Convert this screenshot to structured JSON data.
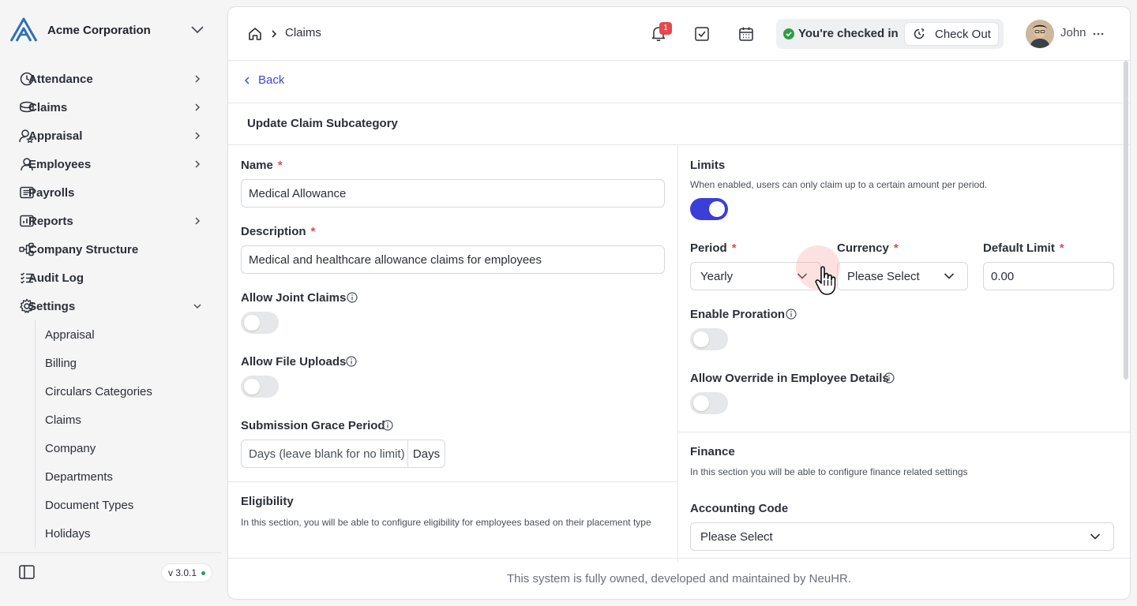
{
  "org": {
    "name": "Acme Corporation"
  },
  "sidebar": {
    "items": [
      {
        "label": "Attendance",
        "icon": "clock-icon"
      },
      {
        "label": "Claims",
        "icon": "coins-icon"
      },
      {
        "label": "Appraisal",
        "icon": "user-star-icon"
      },
      {
        "label": "Employees",
        "icon": "user-icon"
      },
      {
        "label": "Payrolls",
        "icon": "receipt-icon"
      },
      {
        "label": "Reports",
        "icon": "chart-icon"
      },
      {
        "label": "Company Structure",
        "icon": "hierarchy-icon"
      },
      {
        "label": "Audit Log",
        "icon": "list-check-icon"
      },
      {
        "label": "Settings",
        "icon": "gear-icon"
      }
    ],
    "settings_sub": [
      "Appraisal",
      "Billing",
      "Circulars Categories",
      "Claims",
      "Company",
      "Departments",
      "Document Types",
      "Holidays"
    ],
    "version": "v 3.0.1"
  },
  "header": {
    "breadcrumb": "Claims",
    "notification_count": "1",
    "checkin_status": "You're checked in",
    "checkout_label": "Check Out",
    "user_name": "John"
  },
  "page": {
    "back_label": "Back",
    "title": "Update Claim Subcategory",
    "footer": "This system is fully owned, developed and maintained by NeuHR."
  },
  "form": {
    "name_label": "Name",
    "name_value": "Medical Allowance",
    "description_label": "Description",
    "description_value": "Medical and healthcare allowance claims for employees",
    "joint_label": "Allow Joint Claims",
    "joint_enabled": false,
    "uploads_label": "Allow File Uploads",
    "uploads_enabled": false,
    "grace_label": "Submission Grace Period",
    "grace_placeholder": "Days (leave blank for no limit)",
    "grace_unit": "Days",
    "eligibility_label": "Eligibility",
    "eligibility_help": "In this section, you will be able to configure eligibility for employees based on their placement type",
    "limits_label": "Limits",
    "limits_help": "When enabled, users can only claim up to a certain amount per period.",
    "limits_enabled": true,
    "period_label": "Period",
    "period_value": "Yearly",
    "currency_label": "Currency",
    "currency_value": "Please Select",
    "default_limit_label": "Default Limit",
    "default_limit_value": "0.00",
    "proration_label": "Enable Proration",
    "proration_enabled": false,
    "override_label": "Allow Override in Employee Details",
    "override_enabled": false,
    "finance_label": "Finance",
    "finance_help": "In this section you will be able to configure finance related settings",
    "accounting_label": "Accounting Code",
    "accounting_value": "Please Select"
  },
  "colors": {
    "accent": "#3b3fd9",
    "link": "#3b49df",
    "required": "#e5484d",
    "success": "#2f9e44"
  }
}
